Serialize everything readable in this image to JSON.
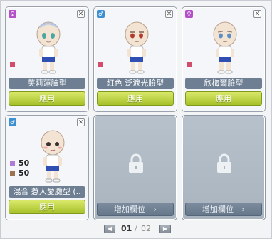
{
  "colors": {
    "female_badge": "#b451c8",
    "male_badge": "#3d8fd1",
    "face_red_swatch": "#d14d6b",
    "mix_swatch_a": "#b07bd6",
    "mix_swatch_b": "#9b7351",
    "apply_button": "#b6cd3b",
    "namebar": "#6e7f93",
    "add_slot_button": "#6d7e91"
  },
  "cards": [
    {
      "gender": "female",
      "gender_icon": "female-symbol-icon",
      "name": "芙莉蓮臉型",
      "apply_label": "應用",
      "eye_color": "#4aa7a0"
    },
    {
      "gender": "male",
      "gender_icon": "male-symbol-icon",
      "name": "紅色 泛淚光臉型",
      "apply_label": "應用",
      "eye_color": "#b23a2c"
    },
    {
      "gender": "female",
      "gender_icon": "female-symbol-icon",
      "name": "欣梅爾臉型",
      "apply_label": "應用",
      "eye_color": "#5d8fc7"
    },
    {
      "gender": "male",
      "gender_icon": "male-symbol-icon",
      "name": "混合 惹人愛臉型 (..",
      "apply_label": "應用",
      "mix_ratio_a": "50",
      "mix_ratio_b": "50",
      "eye_color": "#3b3030"
    }
  ],
  "locked_slots": [
    {
      "label": "增加欄位",
      "icon": "lock-icon"
    },
    {
      "label": "增加欄位",
      "icon": "lock-icon"
    }
  ],
  "pagination": {
    "current": "01",
    "separator": "/",
    "total": "02"
  }
}
